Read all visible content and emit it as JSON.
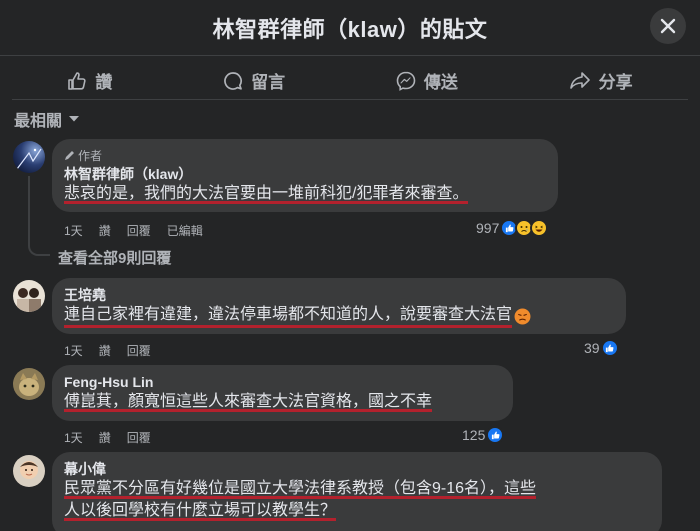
{
  "header": {
    "title": "林智群律師（klaw）的貼文"
  },
  "actions": {
    "like": "讚",
    "comment": "留言",
    "share_messenger": "傳送",
    "share": "分享"
  },
  "sort": {
    "label": "最相關"
  },
  "comments": [
    {
      "author_badge": "作者",
      "name": "林智群律師（klaw）",
      "text": "悲哀的是，我們的大法官要由一堆前科犯/犯罪者來審查。",
      "time": "1天",
      "like": "讚",
      "reply": "回覆",
      "edited": "已編輯",
      "reaction_count": "997",
      "reaction_icons": [
        "like-icon",
        "sad-icon",
        "haha-icon"
      ]
    },
    {
      "name": "王培堯",
      "text": "連自己家裡有違建，違法停車場都不知道的人，說要審查大法官",
      "time": "1天",
      "like": "讚",
      "reply": "回覆",
      "reaction_count": "39",
      "reaction_icons": [
        "like-icon"
      ]
    },
    {
      "name": "Feng-Hsu Lin",
      "text": "傅崑萁，顏寬恒這些人來審查大法官資格，國之不幸",
      "time": "1天",
      "like": "讚",
      "reply": "回覆",
      "reaction_count": "125",
      "reaction_icons": [
        "like-icon"
      ]
    },
    {
      "name": "幕小偉",
      "text_line1": "民眾黨不分區有好幾位是國立大學法律系教授（包含9-16名），這些",
      "text_line2": "人以後回學校有什麼立場可以教學生？"
    }
  ],
  "view_replies": "查看全部9則回覆",
  "colors": {
    "background": "#242526",
    "bubble": "#3a3b3c",
    "text": "#e4e6eb",
    "secondary": "#b0b3b8",
    "like_blue": "#1877f2",
    "underline_red": "#b3212d"
  }
}
